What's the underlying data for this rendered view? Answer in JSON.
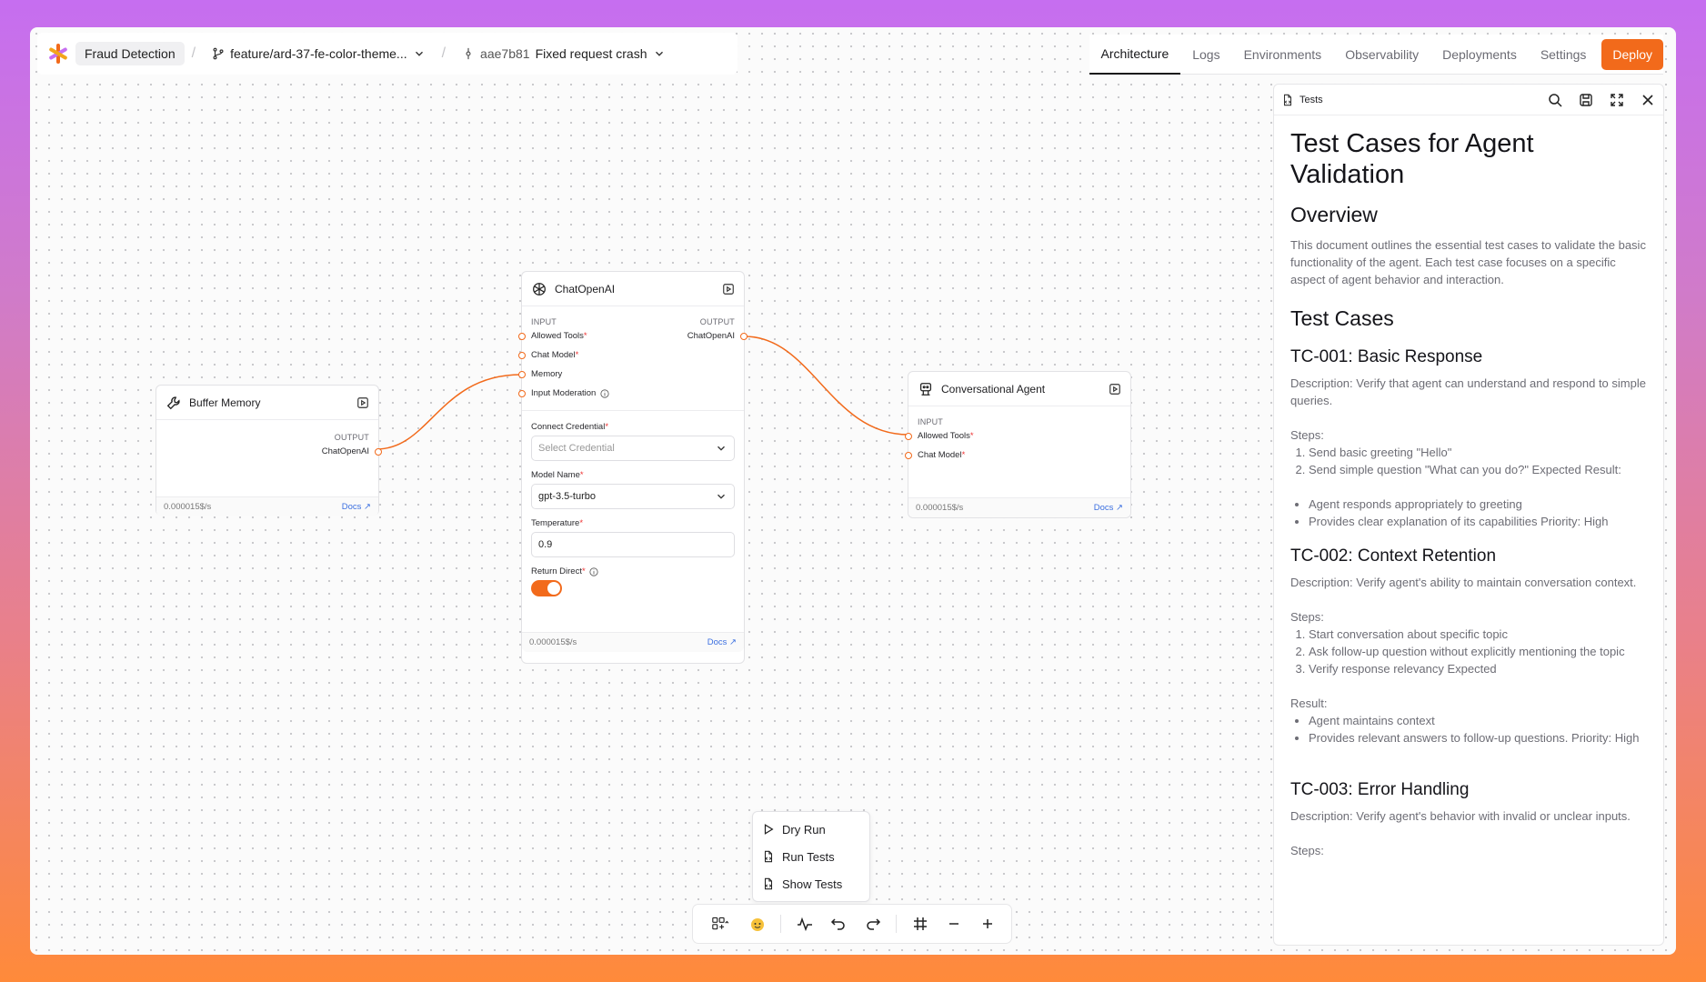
{
  "header": {
    "project": "Fraud Detection",
    "branch": "feature/ard-37-fe-color-theme...",
    "commit_hash": "aae7b81",
    "commit_message": "Fixed request crash"
  },
  "tabs": [
    "Architecture",
    "Logs",
    "Environments",
    "Observability",
    "Deployments",
    "Settings"
  ],
  "active_tab": "Architecture",
  "deploy_label": "Deploy",
  "colors": {
    "accent": "#f26a1b",
    "link": "#3b6fe0"
  },
  "nodes": {
    "buffer_memory": {
      "title": "Buffer Memory",
      "output_label": "OUTPUT",
      "output_port": "ChatOpenAI",
      "cost": "0.000015$/s",
      "docs": "Docs"
    },
    "chat_openai": {
      "title": "ChatOpenAI",
      "input_label": "INPUT",
      "output_label": "OUTPUT",
      "inputs": [
        "Allowed Tools",
        "Chat Model",
        "Memory",
        "Input Moderation"
      ],
      "output_port": "ChatOpenAI",
      "credential_label": "Connect Credential",
      "credential_placeholder": "Select Credential",
      "model_label": "Model Name",
      "model_value": "gpt-3.5-turbo",
      "temperature_label": "Temperature",
      "temperature_value": "0.9",
      "return_direct_label": "Return Direct",
      "return_direct_on": true,
      "cost": "0.000015$/s",
      "docs": "Docs"
    },
    "conversational_agent": {
      "title": "Conversational Agent",
      "input_label": "INPUT",
      "inputs": [
        "Allowed Tools",
        "Chat Model"
      ],
      "cost": "0.000015$/s",
      "docs": "Docs"
    }
  },
  "tests_panel": {
    "title": "Tests",
    "doc_title": "Test Cases for Agent Validation",
    "overview_heading": "Overview",
    "overview_text": "This document outlines the essential test cases to validate the basic functionality of the agent. Each test case focuses on a specific aspect of agent behavior and interaction.",
    "test_cases_heading": "Test Cases",
    "tc1": {
      "heading": "TC-001: Basic Response",
      "description": "Description: Verify that agent can understand and respond to simple queries.",
      "steps_label": "Steps:",
      "steps": [
        "Send basic greeting \"Hello\"",
        "Send simple question \"What can you do?\" Expected Result:"
      ],
      "bullets": [
        "Agent responds appropriately to greeting",
        "Provides clear explanation of its capabilities Priority: High"
      ]
    },
    "tc2": {
      "heading": "TC-002: Context Retention",
      "description": "Description: Verify agent's ability to maintain conversation context.",
      "steps_label": "Steps:",
      "steps": [
        "Start conversation about specific topic",
        "Ask follow-up question without explicitly mentioning the topic",
        "Verify response relevancy Expected"
      ],
      "result_label": "Result:",
      "bullets": [
        "Agent maintains context",
        "Provides relevant answers to follow-up questions. Priority: High"
      ]
    },
    "tc3": {
      "heading": "TC-003: Error Handling",
      "description": "Description: Verify agent's behavior with invalid or unclear inputs.",
      "steps_label": "Steps:"
    }
  },
  "menu": [
    "Dry Run",
    "Run Tests",
    "Show Tests"
  ],
  "toolbar_icons": [
    "layout-icon",
    "emoji-icon",
    "activity-icon",
    "undo-icon",
    "redo-icon",
    "grid-icon",
    "zoom-out-icon",
    "zoom-in-icon"
  ]
}
